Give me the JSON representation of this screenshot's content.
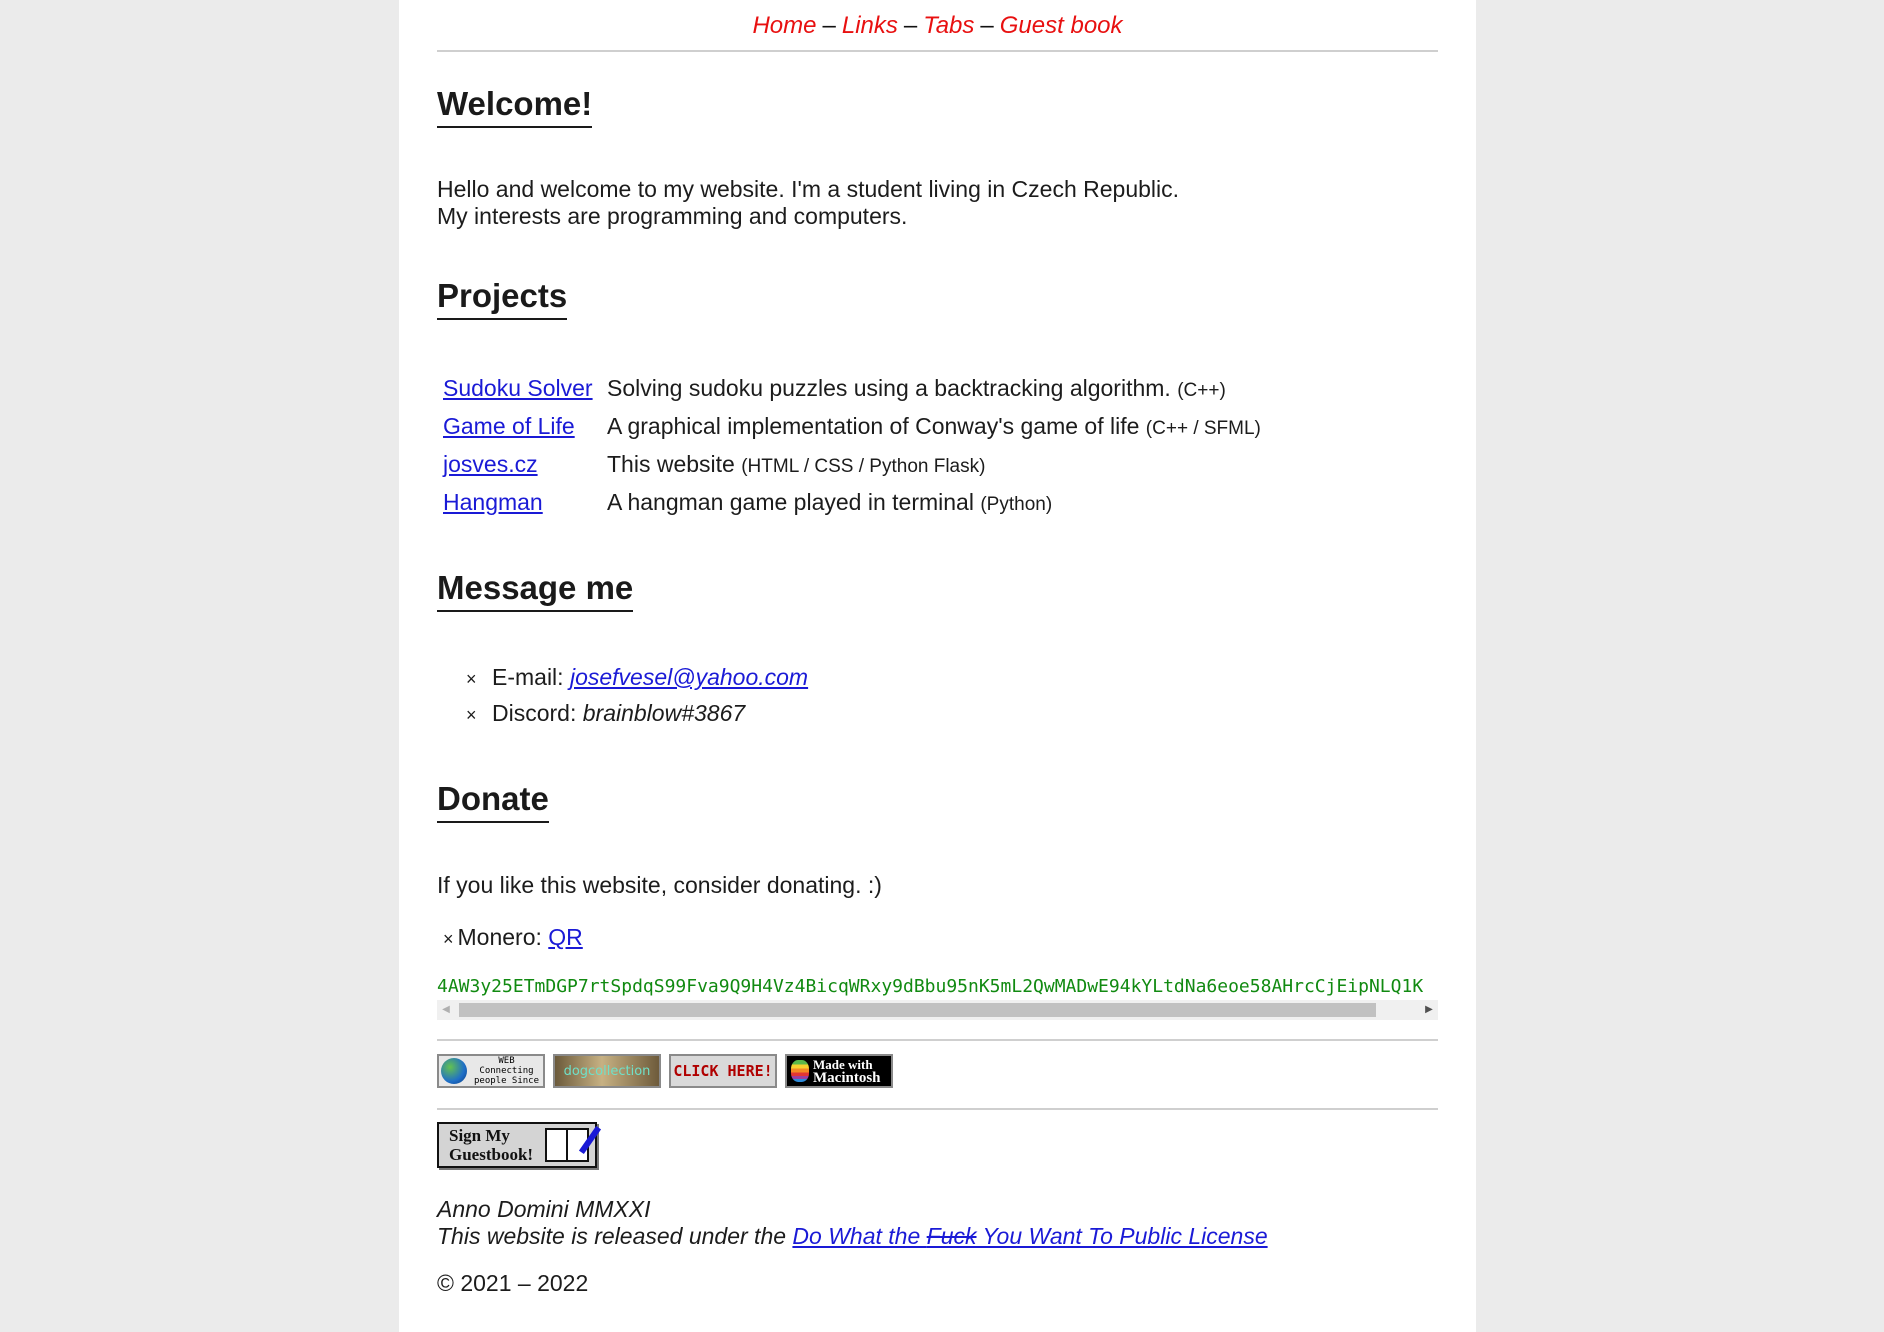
{
  "nav": {
    "items": [
      "Home",
      "Links",
      "Tabs",
      "Guest book"
    ],
    "separator": "–"
  },
  "welcome": {
    "heading": "Welcome!",
    "line1": "Hello and welcome to my website. I'm a student living in Czech Republic.",
    "line2": "My interests are programming and computers."
  },
  "projects": {
    "heading": "Projects",
    "rows": [
      {
        "name": "Sudoku Solver",
        "desc": "Solving sudoku puzzles using a backtracking algorithm.",
        "tech": "(C++)"
      },
      {
        "name": "Game of Life",
        "desc": "A graphical implementation of Conway's game of life",
        "tech": "(C++ / SFML)"
      },
      {
        "name": "josves.cz",
        "desc": "This website",
        "tech": "(HTML / CSS / Python Flask)"
      },
      {
        "name": "Hangman",
        "desc": "A hangman game played in terminal",
        "tech": "(Python)"
      }
    ]
  },
  "message": {
    "heading": "Message me",
    "bullet": "×",
    "email_label": "E-mail:",
    "email": "josefvesel@yahoo.com",
    "discord_label": "Discord:",
    "discord": "brainblow#3867"
  },
  "donate": {
    "heading": "Donate",
    "text": "If you like this website, consider donating. :)",
    "monero_label": "Monero:",
    "qr_link": "QR",
    "address": "4AW3y25ETmDGP7rtSpdqS99Fva9Q9H4Vz4BicqWRxy9dBbu95nK5mL2QwMADwE94kYLtdNa6eoe58AHrcCjEipNLQ1K"
  },
  "badges": {
    "www": "WORLD WIDE WEB Connecting people Since 1991",
    "dog": "dogcollection",
    "click": "CLICK HERE!",
    "mac_top": "Made with",
    "mac_bottom": "Macintosh"
  },
  "guestbook": {
    "line1": "Sign My",
    "line2": "Guestbook!"
  },
  "footer": {
    "anno": "Anno Domini MMXXI",
    "license_prefix": "This website is released under the ",
    "license_a": "Do What the ",
    "license_struck": "Fuck",
    "license_b": " You Want To Public License",
    "copyright": "© 2021 – 2022"
  }
}
